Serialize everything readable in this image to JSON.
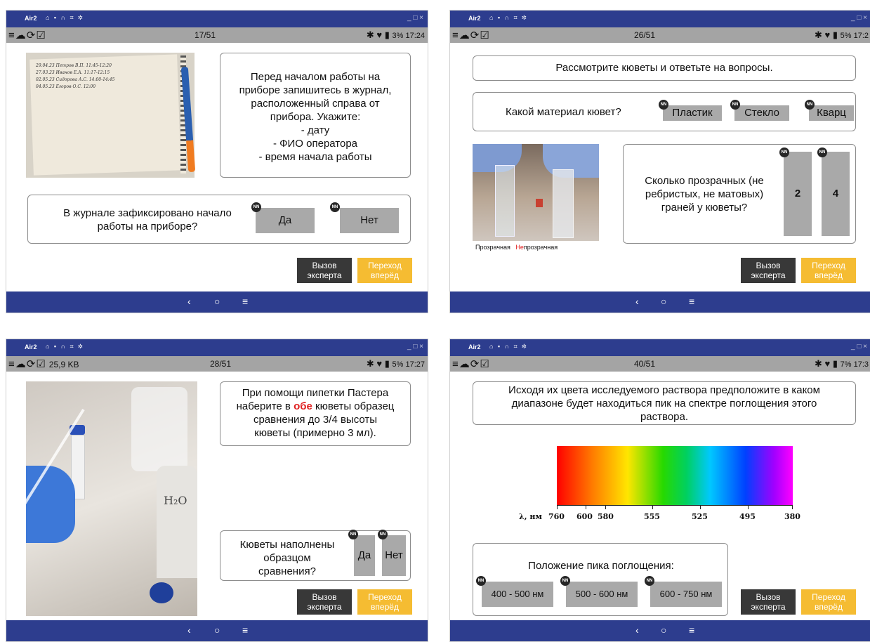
{
  "common": {
    "app_name": "Air2",
    "tray_icons": "⌂ ▪ ∩ ⌗ ✲",
    "window_controls": "_ □ ×",
    "status_icons": "≡☁⟳☑",
    "nav": {
      "back": "‹",
      "home": "○",
      "menu": "≡"
    },
    "nn": "NN",
    "expert_line1": "Вызов",
    "expert_line2": "эксперта",
    "next_line1": "Переход",
    "next_line2": "вперёд",
    "colors": {
      "titlebar": "#2d3d8e",
      "statusbar": "#a4a4a4",
      "button": "#a9a9a9",
      "next": "#f5bc32",
      "expert": "#383838",
      "highlight": "#e02020"
    }
  },
  "screens": [
    {
      "counter": "17/51",
      "status": "3% 17:24",
      "instruction_lines": [
        "Перед началом работы на",
        "приборе запишитесь в журнал,",
        "расположенный справа от",
        "прибора. Укажите:",
        "- дату",
        "- ФИО оператора",
        "- время начала работы"
      ],
      "question_lines": [
        "В журнале зафиксировано начало",
        "работы на приборе?"
      ],
      "options": [
        "Да",
        "Нет"
      ],
      "notebook_lines": [
        "29.04.23  Петров В.П.  11:45-12:20",
        "27.03.23  Иванов Е.А.  11:17-12:15",
        "02.05.23  Сидорова А.С.  14:00-14:45",
        "04.05.23  Егоров О.С.  12:00"
      ]
    },
    {
      "counter": "26/51",
      "status": "5% 17:2",
      "heading": "Рассмотрите кюветы и ответьте на вопросы.",
      "question1": "Какой материал кювет?",
      "options1": [
        "Пластик",
        "Стекло",
        "Кварц"
      ],
      "question2_lines": [
        "Сколько прозрачных (не",
        "ребристых, не матовых)",
        "граней у кюветы?"
      ],
      "options2": [
        "2",
        "4"
      ],
      "caption_left": "Прозрачная",
      "caption_right_red": "Не",
      "caption_right_rest": "прозрачная"
    },
    {
      "counter": "28/51",
      "status": "5% 17:27",
      "extra_status": "25,9 KB",
      "instruction_line1": "При помощи пипетки Пастера",
      "instruction_line2_pre": "наберите в ",
      "instruction_line2_red": "обе",
      "instruction_line2_post": " кюветы образец",
      "instruction_line3": "сравнения до 3/4 высоты",
      "instruction_line4": "кюветы (примерно 3 мл).",
      "question_lines": [
        "Кюветы наполнены",
        "образцом",
        "сравнения?"
      ],
      "options": [
        "Да",
        "Нет"
      ],
      "bottle_label": "H₂O"
    },
    {
      "counter": "40/51",
      "status": "7% 17:3",
      "heading_lines": [
        "Исходя их цвета исследуемого раствора предположите в каком",
        "диапазоне будет находиться пик на спектре поглощения этого",
        "раствора."
      ],
      "axis_label": "λ, нм",
      "wavelength_ticks": [
        "760",
        "600",
        "580",
        "555",
        "525",
        "495",
        "380"
      ],
      "question": "Положение пика поглощения:",
      "options": [
        "400 - 500 нм",
        "500 - 600 нм",
        "600 - 750 нм"
      ]
    }
  ]
}
